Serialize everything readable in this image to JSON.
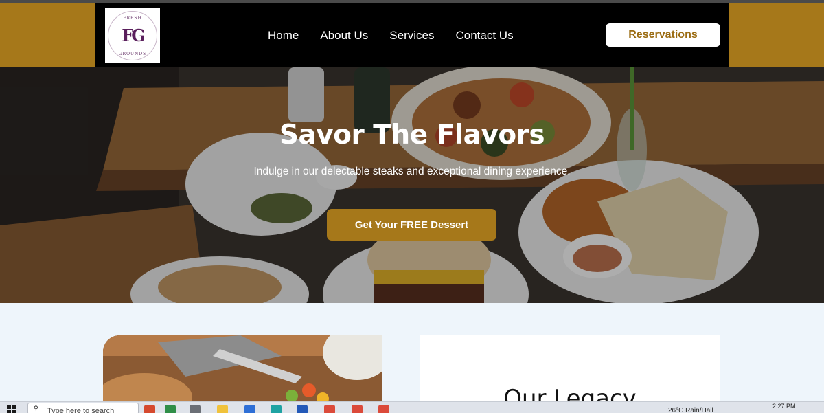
{
  "header": {
    "logo": {
      "top_text": "FRESH",
      "mark": "FG",
      "bottom_text": "GROUNDS"
    },
    "nav": [
      {
        "label": "Home"
      },
      {
        "label": "About Us"
      },
      {
        "label": "Services"
      },
      {
        "label": "Contact Us"
      }
    ],
    "reservations_label": "Reservations"
  },
  "hero": {
    "title": "Savor The Flavors",
    "subtitle": "Indulge in our delectable steaks and exceptional dining experience.",
    "cta_label": "Get Your FREE Dessert"
  },
  "legacy": {
    "title": "Our Legacy"
  },
  "taskbar": {
    "search_placeholder": "Type here to search",
    "weather": "26°C  Rain/Hail",
    "time": "2:27 PM"
  },
  "colors": {
    "brand_gold": "#a6781a",
    "header_bg": "#000000",
    "section_bg": "#eef5fb"
  },
  "icons": {
    "search": "search-icon",
    "windows": "windows-start-icon"
  }
}
